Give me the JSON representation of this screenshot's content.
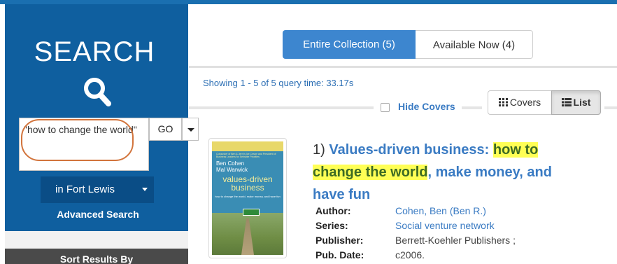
{
  "sidebar": {
    "search_title": "SEARCH",
    "query": "\"how to change the world\"",
    "go_label": "GO",
    "location_label": "in Fort Lewis",
    "advanced_search": "Advanced Search",
    "sort_results_by": "Sort Results By"
  },
  "tabs": [
    {
      "label": "Entire Collection (5)",
      "active": true
    },
    {
      "label": "Available Now (4)",
      "active": false
    }
  ],
  "results": {
    "showing": "Showing 1 - 5 of 5 query time: 33.17s",
    "hide_covers": "Hide Covers",
    "view_covers": "Covers",
    "view_list": "List"
  },
  "item": {
    "number": "1)",
    "title_part1": "Values-driven business:",
    "title_highlight1": "how to",
    "title_highlight2": "change the world",
    "title_part2": ", make money, and",
    "title_part3": "have fun",
    "author_label": "Author:",
    "author": "Cohen, Ben (Ben R.)",
    "series_label": "Series:",
    "series": "Social venture network",
    "publisher_label": "Publisher:",
    "publisher": "Berrett-Koehler Publishers ;",
    "pubdate_label": "Pub. Date:",
    "pubdate": "c2006."
  },
  "cover": {
    "tagline": "Cofounder of Ben & Jerry's Ice Cream and President of Business Leaders for Sensible Priorities",
    "author1": "Ben Cohen",
    "author2": "Mal Warwick",
    "title1": "values-driven",
    "title2": "business",
    "subtitle": "how to change the world, make money, and have fun"
  },
  "colors": {
    "sidebar_blue": "#0f5f9f",
    "accent_blue": "#3d86cf",
    "highlight_yellow": "#ffff55",
    "annotation_orange": "#d2743c"
  }
}
